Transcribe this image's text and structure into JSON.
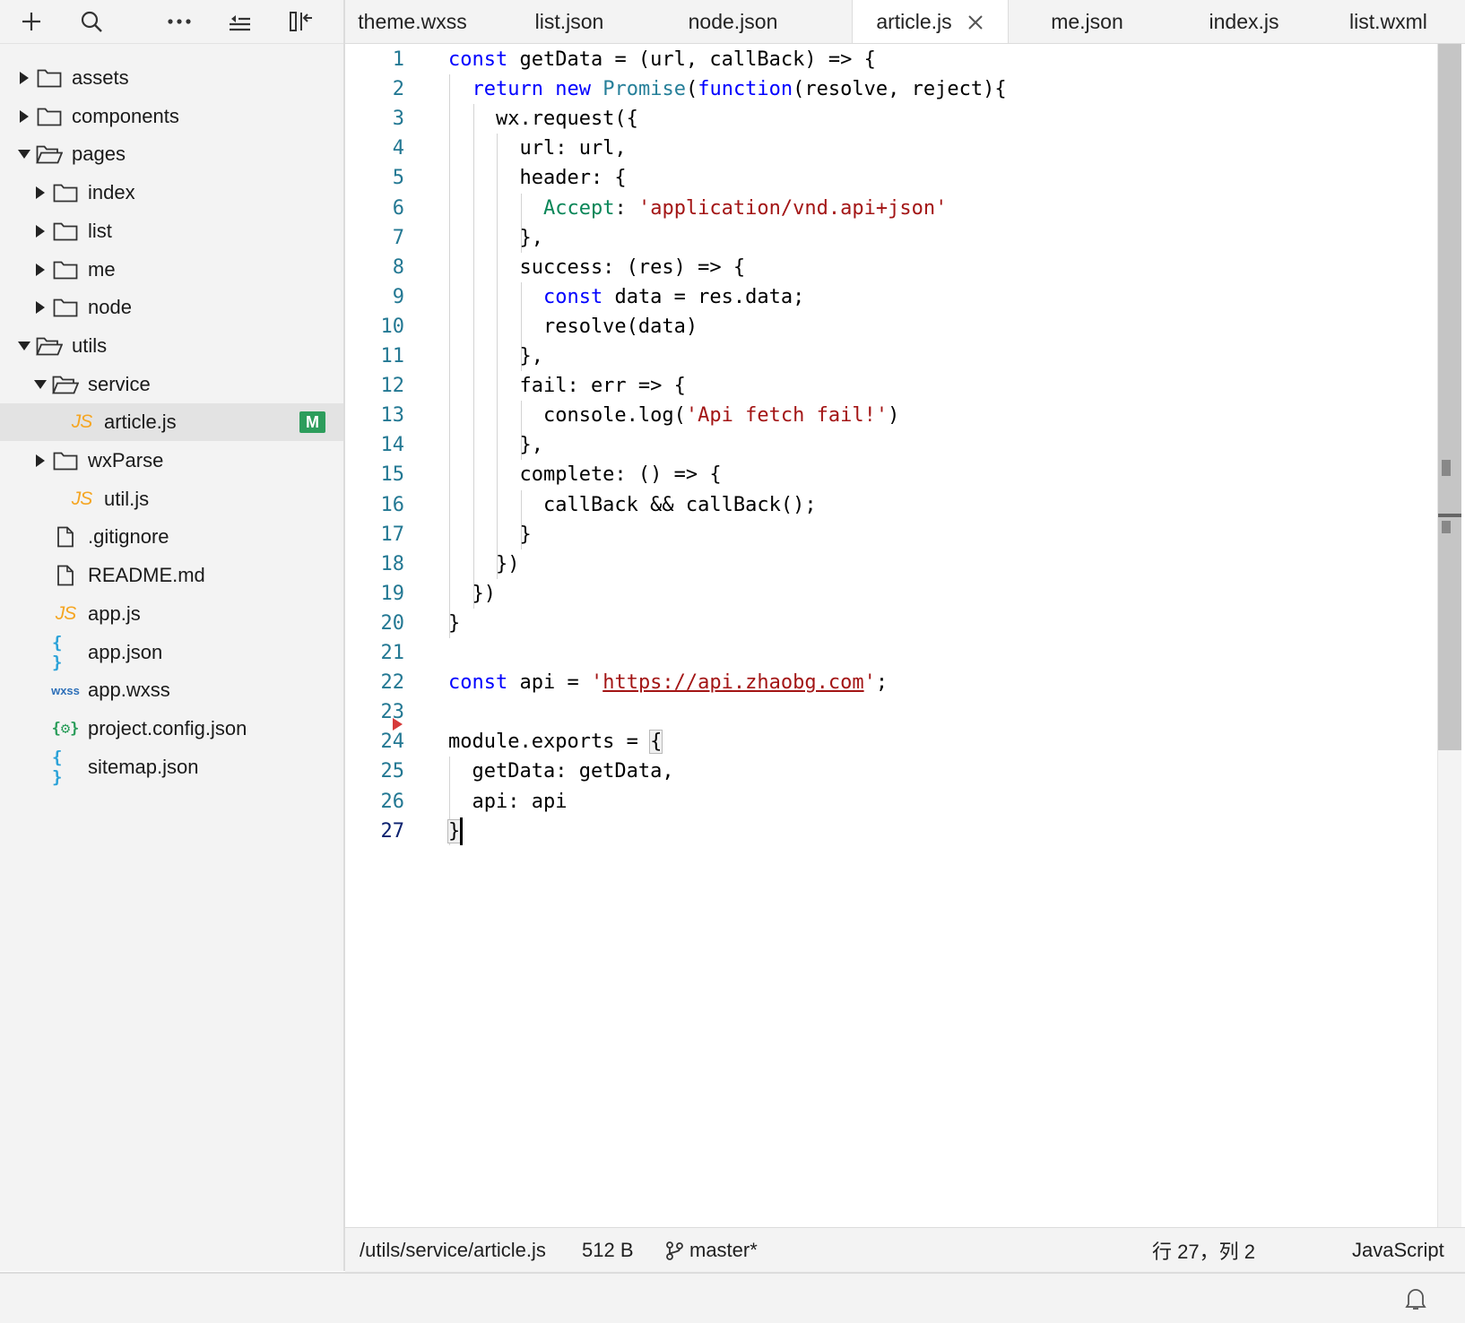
{
  "sidebar": {
    "toolbar": {
      "add_icon": "plus-icon",
      "search_icon": "search-icon",
      "more_icon": "more-icon",
      "collapse_icon": "collapse-all-icon",
      "panel_icon": "hide-sidebar-icon"
    },
    "tree": [
      {
        "label": "assets",
        "type": "folder",
        "expanded": false
      },
      {
        "label": "components",
        "type": "folder",
        "expanded": false
      },
      {
        "label": "pages",
        "type": "folder",
        "expanded": true
      },
      {
        "label": "index",
        "type": "folder",
        "expanded": false
      },
      {
        "label": "list",
        "type": "folder",
        "expanded": false
      },
      {
        "label": "me",
        "type": "folder",
        "expanded": false
      },
      {
        "label": "node",
        "type": "folder",
        "expanded": false
      },
      {
        "label": "utils",
        "type": "folder",
        "expanded": true
      },
      {
        "label": "service",
        "type": "folder",
        "expanded": true
      },
      {
        "label": "article.js",
        "type": "js",
        "selected": true,
        "badge": "M"
      },
      {
        "label": "wxParse",
        "type": "folder",
        "expanded": false
      },
      {
        "label": "util.js",
        "type": "js"
      },
      {
        "label": ".gitignore",
        "type": "file"
      },
      {
        "label": "README.md",
        "type": "file"
      },
      {
        "label": "app.js",
        "type": "js"
      },
      {
        "label": "app.json",
        "type": "json"
      },
      {
        "label": "app.wxss",
        "type": "wxss"
      },
      {
        "label": "project.config.json",
        "type": "config"
      },
      {
        "label": "sitemap.json",
        "type": "json"
      }
    ],
    "icon_text": {
      "js": "JS",
      "json": "{ }",
      "wxss": "wxss",
      "config": "{⚙}"
    }
  },
  "tabs": [
    {
      "label": "theme.wxss",
      "active": false
    },
    {
      "label": "list.json",
      "active": false
    },
    {
      "label": "node.json",
      "active": false
    },
    {
      "label": "article.js",
      "active": true
    },
    {
      "label": "me.json",
      "active": false
    },
    {
      "label": "index.js",
      "active": false
    },
    {
      "label": "list.wxml",
      "active": false
    }
  ],
  "editor": {
    "current_line": 27,
    "lines": [
      [
        [
          "kw",
          "const"
        ],
        [
          "",
          "  getData = (url, callBack) => {"
        ]
      ],
      [
        [
          "",
          "  "
        ],
        [
          "kw",
          "return"
        ],
        [
          "",
          " "
        ],
        [
          "kw",
          "new"
        ],
        [
          "",
          " "
        ],
        [
          "ty",
          "Promise"
        ],
        [
          "",
          "("
        ],
        [
          "kw",
          "function"
        ],
        [
          "",
          "(resolve, reject){"
        ]
      ],
      [
        [
          "",
          "    wx.request({"
        ]
      ],
      [
        [
          "",
          "      url: url,"
        ]
      ],
      [
        [
          "",
          "      header: {"
        ]
      ],
      [
        [
          "",
          "        "
        ],
        [
          "pr",
          "Accept"
        ],
        [
          "",
          ": "
        ],
        [
          "st",
          "'application/vnd.api+json'"
        ]
      ],
      [
        [
          "",
          "      },"
        ]
      ],
      [
        [
          "",
          "      success: (res) => {"
        ]
      ],
      [
        [
          "",
          "        "
        ],
        [
          "kw",
          "const"
        ],
        [
          "",
          " data = res.data;"
        ]
      ],
      [
        [
          "",
          "        resolve(data)"
        ]
      ],
      [
        [
          "",
          "      },"
        ]
      ],
      [
        [
          "",
          "      fail: err => {"
        ]
      ],
      [
        [
          "",
          "        console.log("
        ],
        [
          "st",
          "'Api fetch fail!'"
        ],
        [
          "",
          ")"
        ]
      ],
      [
        [
          "",
          "      },"
        ]
      ],
      [
        [
          "",
          "      complete: () => {"
        ]
      ],
      [
        [
          "",
          "        callBack && callBack();"
        ]
      ],
      [
        [
          "",
          "      }"
        ]
      ],
      [
        [
          "",
          "    })"
        ]
      ],
      [
        [
          "",
          "  })"
        ]
      ],
      [
        [
          "",
          "}"
        ]
      ],
      [],
      [
        [
          "kw",
          "const"
        ],
        [
          "",
          " api = "
        ],
        [
          "st",
          "'"
        ],
        [
          "url",
          "https://api.zhaobg.com"
        ],
        [
          "st",
          "'"
        ],
        [
          "",
          ";"
        ]
      ],
      [],
      [
        [
          "",
          "module.exports = "
        ],
        [
          "hl",
          "{"
        ]
      ],
      [
        [
          "",
          "  getData: getData,"
        ]
      ],
      [
        [
          "",
          "  api: api"
        ]
      ],
      [
        [
          "hl",
          "}"
        ]
      ]
    ]
  },
  "status": {
    "path": "/utils/service/article.js",
    "size": "512 B",
    "branch": "master*",
    "position": "行 27，列 2",
    "language": "JavaScript"
  },
  "bell_icon": "bell-icon",
  "colors": {
    "keyword": "#0000ff",
    "type": "#267f99",
    "property": "#098658",
    "string": "#a31515",
    "line_number": "#237893",
    "badge_modified": "#2d9d5c"
  }
}
